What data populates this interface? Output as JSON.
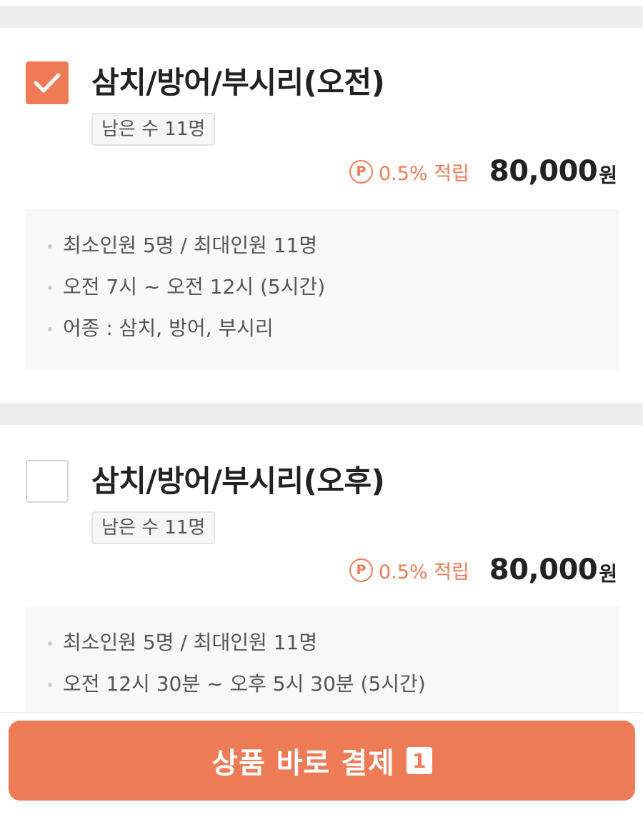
{
  "products": [
    {
      "checked": true,
      "title": "삼치/방어/부시리(오전)",
      "remaining": "남은 수 11명",
      "points": "0.5% 적립",
      "point_icon": "P",
      "price": "80,000",
      "currency": "원",
      "details": [
        "최소인원 5명 / 최대인원 11명",
        "오전 7시 ~ 오전 12시 (5시간)",
        "어종 : 삼치, 방어, 부시리"
      ]
    },
    {
      "checked": false,
      "title": "삼치/방어/부시리(오후)",
      "remaining": "남은 수 11명",
      "points": "0.5% 적립",
      "point_icon": "P",
      "price": "80,000",
      "currency": "원",
      "details": [
        "최소인원 5명 / 최대인원 11명",
        "오전 12시 30분 ~ 오후 5시 30분 (5시간)"
      ]
    }
  ],
  "checkout": {
    "label": "상품 바로 결제",
    "count": "1"
  },
  "colors": {
    "accent": "#ed7b56",
    "divider": "#eeeeee",
    "info_bg": "#f8f8f8"
  }
}
